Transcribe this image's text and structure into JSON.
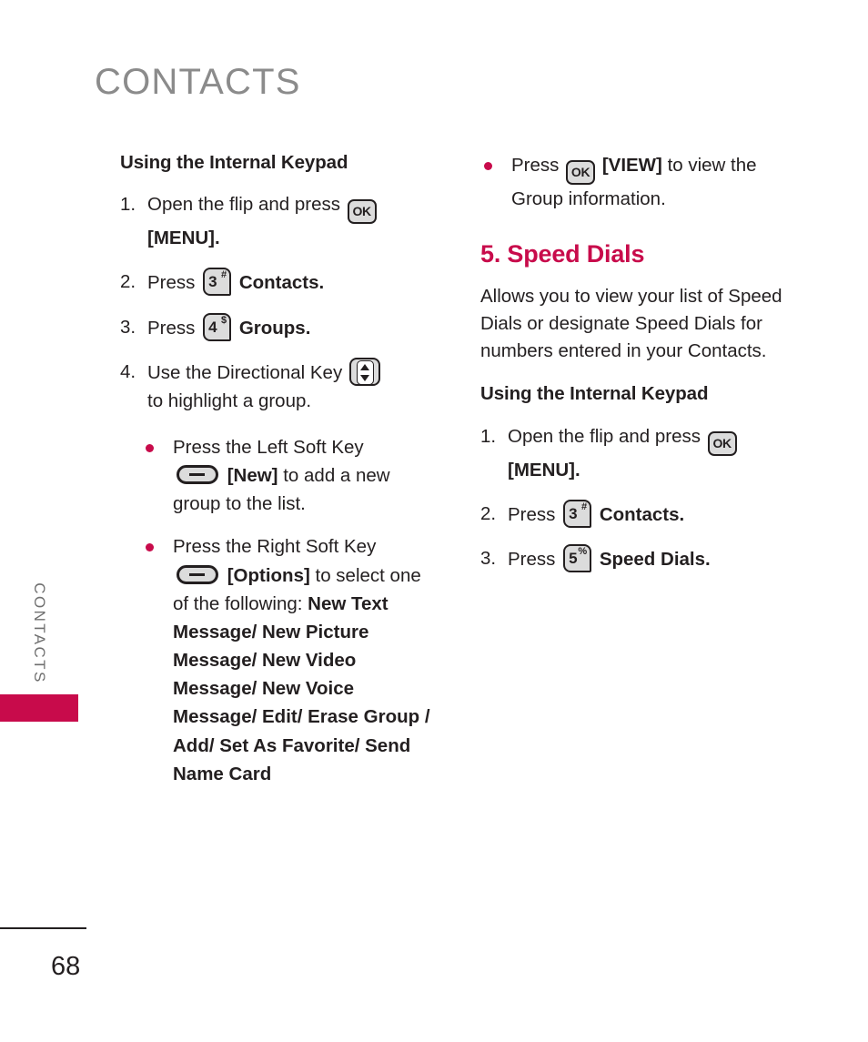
{
  "page": {
    "header_title": "CONTACTS",
    "side_tab_label": "CONTACTS",
    "page_number": "68"
  },
  "icons": {
    "ok_key_label": "OK",
    "key3_digit": "3",
    "key3_sup": "#",
    "key4_digit": "4",
    "key4_sup": "$",
    "key5_digit": "5",
    "key5_sup": "%"
  },
  "left_column": {
    "sub_head": "Using the Internal Keypad",
    "step1": {
      "num": "1.",
      "text_before": "Open the flip and press",
      "text_after": "[MENU]."
    },
    "step2": {
      "num": "2.",
      "text_before": "Press",
      "text_after": "Contacts."
    },
    "step3": {
      "num": "3.",
      "text_before": "Press",
      "text_after": "Groups."
    },
    "step4": {
      "num": "4.",
      "text_before": "Use the Directional Key",
      "text_after": "to highlight a group."
    },
    "bullet1": {
      "line1": "Press the Left Soft Key",
      "bracket": "[New]",
      "line2": "to add a new group to the list."
    },
    "bullet2": {
      "line1": "Press the Right Soft Key",
      "bracket": "[Options]",
      "line2": "to select one of the following:",
      "options": "New Text Message/ New Picture Message/ New Video Message/ New Voice Message/ Edit/ Erase Group / Add/ Set As Favorite/ Send Name Card"
    }
  },
  "right_column": {
    "bullet1": {
      "text_before": "Press",
      "bracket": "[VIEW]",
      "text_after": "to view the Group information."
    },
    "section_head": "5. Speed Dials",
    "paragraph": "Allows you to view your list of Speed Dials or designate Speed Dials for numbers entered in your Contacts.",
    "sub_head": "Using the Internal Keypad",
    "step1": {
      "num": "1.",
      "text_before": "Open the flip and press",
      "text_after": "[MENU]."
    },
    "step2": {
      "num": "2.",
      "text_before": "Press",
      "text_after": "Contacts."
    },
    "step3": {
      "num": "3.",
      "text_before": "Press",
      "text_after": "Speed Dials."
    }
  },
  "colors": {
    "accent": "#c80b4b",
    "header_gray": "#8b8b8b",
    "body": "#231f20"
  }
}
